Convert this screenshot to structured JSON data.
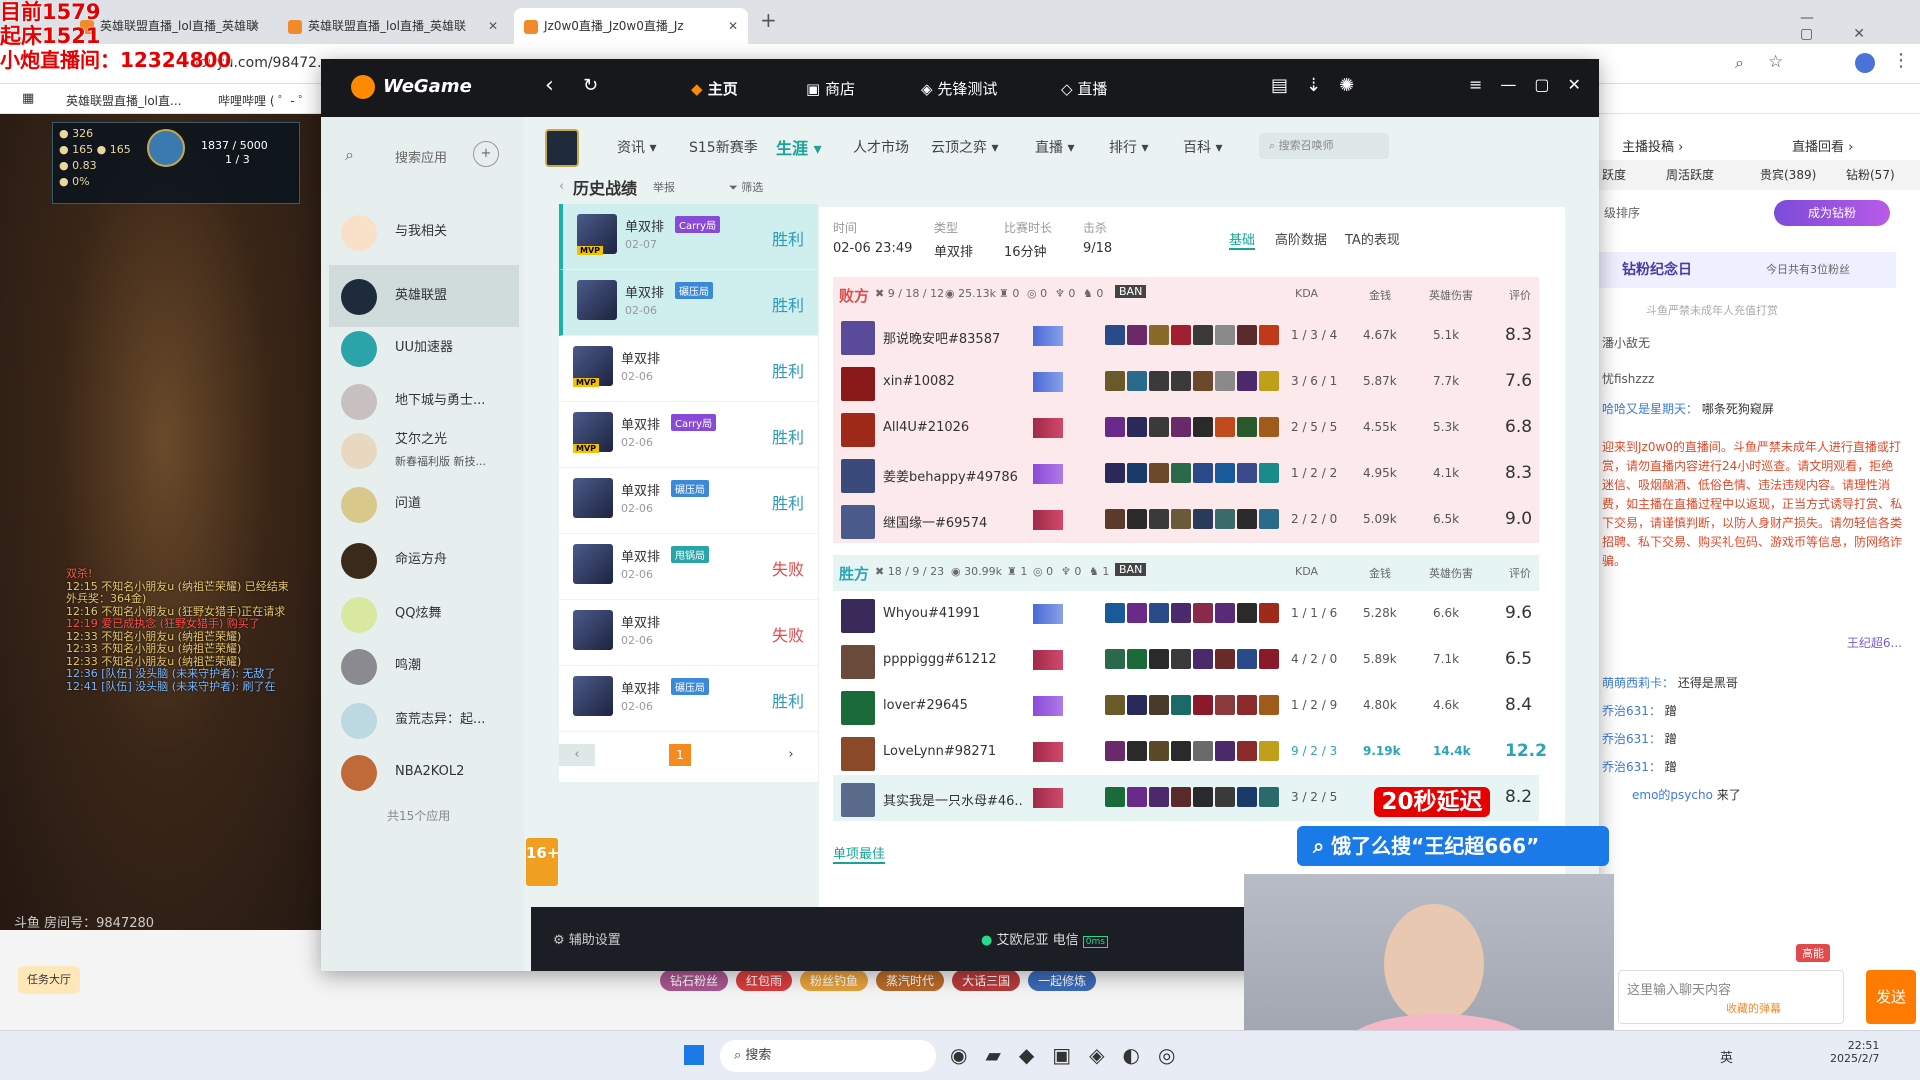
{
  "overlay": {
    "line1": "目前1579",
    "line2": "起床1521",
    "line3": "小炮直播间：12324800"
  },
  "browser": {
    "tabs": [
      {
        "label": "英雄联盟直播_lol直播_英雄联"
      },
      {
        "label": "英雄联盟直播_lol直播_英雄联"
      },
      {
        "label": "Jz0w0直播_Jz0w0直播_Jz"
      }
    ],
    "url": "douyu.com/98472...",
    "bookmarks": [
      {
        "label": "英雄联盟直播_lol直..."
      },
      {
        "label": "哔哩哔哩 ( ゜- ゜"
      }
    ]
  },
  "wegame": {
    "logo": "WeGame",
    "nav": {
      "home": "主页",
      "shop": "商店",
      "test": "先锋测试",
      "live": "直播"
    },
    "sidebar": {
      "search": "搜索应用",
      "apps": [
        {
          "label": "与我相关"
        },
        {
          "label": "英雄联盟"
        },
        {
          "label": "UU加速器"
        },
        {
          "label": "地下城与勇士..."
        },
        {
          "label": "艾尔之光"
        },
        {
          "label": "问道"
        },
        {
          "label": "命运方舟"
        },
        {
          "label": "QQ炫舞"
        },
        {
          "label": "鸣潮"
        },
        {
          "label": "蛮荒志异：起..."
        },
        {
          "label": "NBA2KOL2"
        }
      ],
      "elsword_promo": "新春福利版 新技...",
      "count": "共15个应用"
    },
    "lol_nav": [
      {
        "label": "资讯"
      },
      {
        "label": "S15新赛季"
      },
      {
        "label": "生涯"
      },
      {
        "label": "人才市场"
      },
      {
        "label": "云顶之弈"
      },
      {
        "label": "直播"
      },
      {
        "label": "排行"
      },
      {
        "label": "百科"
      }
    ],
    "summoner_search": "搜索召唤师",
    "history": {
      "title": "历史战绩",
      "report": "举报",
      "filter": "筛选",
      "page": "1",
      "rows": [
        {
          "queue": "单双排",
          "tag": "Carry局",
          "date": "02-07",
          "result": "胜利",
          "mvp": "MVP"
        },
        {
          "queue": "单双排",
          "tag": "碾压局",
          "date": "02-06",
          "result": "胜利",
          "mvp": ""
        },
        {
          "queue": "单双排",
          "tag": "",
          "date": "02-06",
          "result": "胜利",
          "mvp": "MVP"
        },
        {
          "queue": "单双排",
          "tag": "Carry局",
          "date": "02-06",
          "result": "胜利",
          "mvp": "MVP"
        },
        {
          "queue": "单双排",
          "tag": "碾压局",
          "date": "02-06",
          "result": "胜利",
          "mvp": ""
        },
        {
          "queue": "单双排",
          "tag": "甩锅局",
          "date": "02-06",
          "result": "失败",
          "mvp": ""
        },
        {
          "queue": "单双排",
          "tag": "",
          "date": "02-06",
          "result": "失败",
          "mvp": ""
        },
        {
          "queue": "单双排",
          "tag": "碾压局",
          "date": "02-06",
          "result": "胜利",
          "mvp": ""
        }
      ]
    },
    "detail": {
      "time_label": "时间",
      "time": "02-06 23:49",
      "type_label": "类型",
      "type": "单双排",
      "dur_label": "比赛时长",
      "dur": "16分钟",
      "kill_label": "击杀",
      "kill": "9/18",
      "tabs": {
        "basic": "基础",
        "adv": "高阶数据",
        "perf": "TA的表现"
      },
      "cols": {
        "kda": "KDA",
        "gold": "金钱",
        "dmg": "英雄伤害",
        "score": "评价"
      },
      "ban": "BAN",
      "lose": {
        "label": "败方",
        "kda": "9 / 18 / 12",
        "gold": "25.13k",
        "towers": "0",
        "inhib": "0",
        "baron": "0",
        "dragon": "0",
        "players": [
          {
            "name": "那说晚安吧#83587",
            "kda": "1 / 3 / 4",
            "gold": "4.67k",
            "dmg": "5.1k",
            "score": "8.3"
          },
          {
            "name": "xin#10082",
            "kda": "3 / 6 / 1",
            "gold": "5.87k",
            "dmg": "7.7k",
            "score": "7.6"
          },
          {
            "name": "All4U#21026",
            "kda": "2 / 5 / 5",
            "gold": "4.55k",
            "dmg": "5.3k",
            "score": "6.8"
          },
          {
            "name": "姜姜behappy#49786",
            "kda": "1 / 2 / 2",
            "gold": "4.95k",
            "dmg": "4.1k",
            "score": "8.3"
          },
          {
            "name": "继国缘一#69574",
            "kda": "2 / 2 / 0",
            "gold": "5.09k",
            "dmg": "6.5k",
            "score": "9.0"
          }
        ]
      },
      "win": {
        "label": "胜方",
        "kda": "18 / 9 / 23",
        "gold": "30.99k",
        "towers": "1",
        "inhib": "0",
        "baron": "0",
        "dragon": "1",
        "players": [
          {
            "name": "Whyou#41991",
            "kda": "1 / 1 / 6",
            "gold": "5.28k",
            "dmg": "6.6k",
            "score": "9.6"
          },
          {
            "name": "ppppiggg#61212",
            "kda": "4 / 2 / 0",
            "gold": "5.89k",
            "dmg": "7.1k",
            "score": "6.5"
          },
          {
            "name": "lover#29645",
            "kda": "1 / 2 / 9",
            "gold": "4.80k",
            "dmg": "4.6k",
            "score": "8.4"
          },
          {
            "name": "LoveLynn#98271",
            "kda": "9 / 2 / 3",
            "gold": "9.19k",
            "dmg": "14.4k",
            "score": "12.2"
          },
          {
            "name": "其实我是一只水母#46...",
            "kda": "3 / 2 / 5",
            "gold": "",
            "dmg": "",
            "score": "8.2"
          }
        ]
      },
      "best": "单项最佳"
    },
    "bottom": {
      "assist": "辅助设置",
      "server": "艾欧尼亚 电信",
      "ping": "0ms"
    }
  },
  "stream_ui": {
    "delay": "20秒延迟",
    "search_banner": "饿了么搜“王纪超666”",
    "room": "斗鱼 房间号：9847280",
    "task": "任务大厅",
    "chips": [
      {
        "label": "钻石粉丝"
      },
      {
        "label": "红包雨"
      },
      {
        "label": "粉丝钓鱼"
      },
      {
        "label": "蒸汽时代"
      },
      {
        "label": "大话三国"
      },
      {
        "label": "一起修炼"
      }
    ],
    "game_chat": [
      "双杀!",
      "12:15 不知名小朋友u (纳祖芒荣耀) 已经结束",
      "外兵奖：364金)",
      "12:16 不知名小朋友u (狂野女猎手)正在请求",
      "12:19 爱已成执念 (狂野女猎手) 购买了",
      "12:33 不知名小朋友u (纳祖芒荣耀)",
      "12:33 不知名小朋友u (纳祖芒荣耀)",
      "12:33 不知名小朋友u (纳祖芒荣耀)",
      "12:36 [队伍] 没头脑 (未来守护者): 无敌了",
      "12:41 [队伍] 没头脑 (未来守护者): 刷了在"
    ],
    "hud": {
      "gold": "326",
      "cs": "165",
      "cs2": "165",
      "kda": "0.83",
      "pct": "0%",
      "hp": "1837 / 5000",
      "lvl": "1 / 3"
    }
  },
  "chat_panel": {
    "tabs": [
      {
        "label": "主播投稿"
      },
      {
        "label": "直播回看"
      }
    ],
    "subtabs": [
      {
        "label": "跃度"
      },
      {
        "label": "周活跃度"
      },
      {
        "label": "贵宾(389)"
      },
      {
        "label": "钻粉(57)"
      }
    ],
    "rank": "级排序",
    "become": "成为钻粉",
    "anniv": "钻粉纪念日",
    "anniv_today": "今日共有3位粉丝",
    "warn": "斗鱼严禁未成年人充值打赏",
    "msgs": [
      {
        "user": "潘小敌无",
        "text": ""
      },
      {
        "user": "忧fishzzz",
        "text": ""
      },
      {
        "user": "哈哈又是星期天：",
        "text": "哪条死狗窥屏"
      },
      {
        "user": "",
        "text": "迎来到Jz0w0的直播间。斗鱼严禁未成年人进行直播或打赏，请勿直播内容进行24小时巡查。请文明观看，拒绝迷信、吸烟酗酒、低俗色情、违法违规内容。请理性消费，如主播在直播过程中以返现，正当方式诱导打赏、私下交易，请谨慎判断，以防人身财产损失。请勿轻信各类招聘、私下交易、购买礼包码、游戏币等信息，防网络诈骗。"
      },
      {
        "user": "王纪超6...",
        "text": ""
      },
      {
        "user": "萌萌西莉卡：",
        "text": "还得是黑哥"
      },
      {
        "user": "乔治631：",
        "text": "蹭"
      },
      {
        "user": "乔治631：",
        "text": "蹭"
      },
      {
        "user": "乔治631：",
        "text": "蹭"
      },
      {
        "user": "emo的psycho",
        "text": "来了"
      }
    ],
    "input_ph": "这里输入聊天内容",
    "send": "发送",
    "fav": "收藏的弹幕",
    "high": "高能"
  },
  "taskbar": {
    "search": "搜索",
    "time": "22:51",
    "date": "2025/2/7",
    "lang": "英"
  },
  "colors": {
    "teal": "#17a398",
    "lose_bg": "#fbe9ec",
    "win_bg": "#e6f5f4",
    "win": "#2aa4b8",
    "lose": "#e04a4a"
  }
}
